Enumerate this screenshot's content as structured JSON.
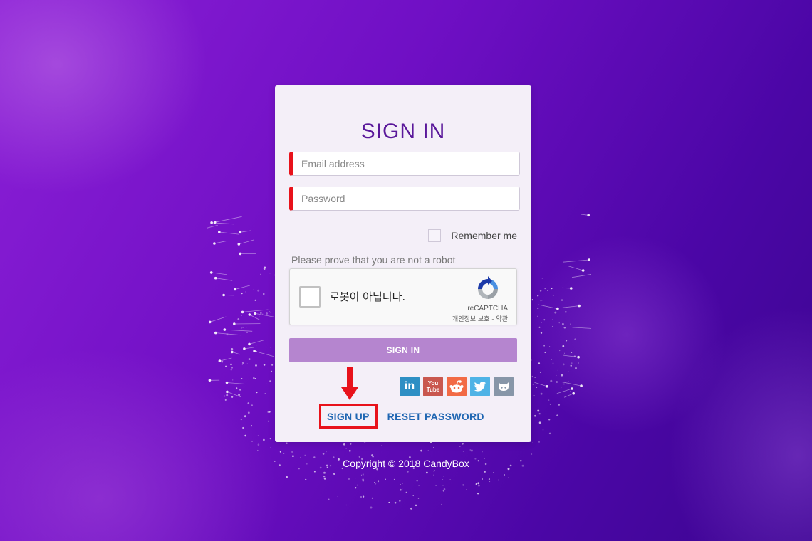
{
  "form": {
    "title": "SIGN IN",
    "email_placeholder": "Email address",
    "password_placeholder": "Password",
    "remember_label": "Remember me",
    "robot_prompt": "Please prove that you are not a robot",
    "submit_label": "SIGN IN"
  },
  "captcha": {
    "label": "로봇이 아닙니다.",
    "brand": "reCAPTCHA",
    "terms": "개인정보 보호 - 약관"
  },
  "socials": [
    {
      "name": "linkedin",
      "glyph": "in",
      "color": "#2e8fc4"
    },
    {
      "name": "youtube",
      "glyph": "You Tube",
      "color": "#c9574f"
    },
    {
      "name": "reddit",
      "glyph": "",
      "color": "#f26a45"
    },
    {
      "name": "twitter",
      "glyph": "",
      "color": "#4fb3e6"
    },
    {
      "name": "github",
      "glyph": "",
      "color": "#8796a8"
    }
  ],
  "links": {
    "signup_label": "SIGN UP",
    "reset_label": "RESET PASSWORD"
  },
  "footer": {
    "copyright": "Copyright © 2018 CandyBox"
  },
  "colors": {
    "accent_purple": "#5a189a",
    "error_bar": "#e8121b",
    "button": "#b585cf",
    "link": "#1f66b2"
  }
}
